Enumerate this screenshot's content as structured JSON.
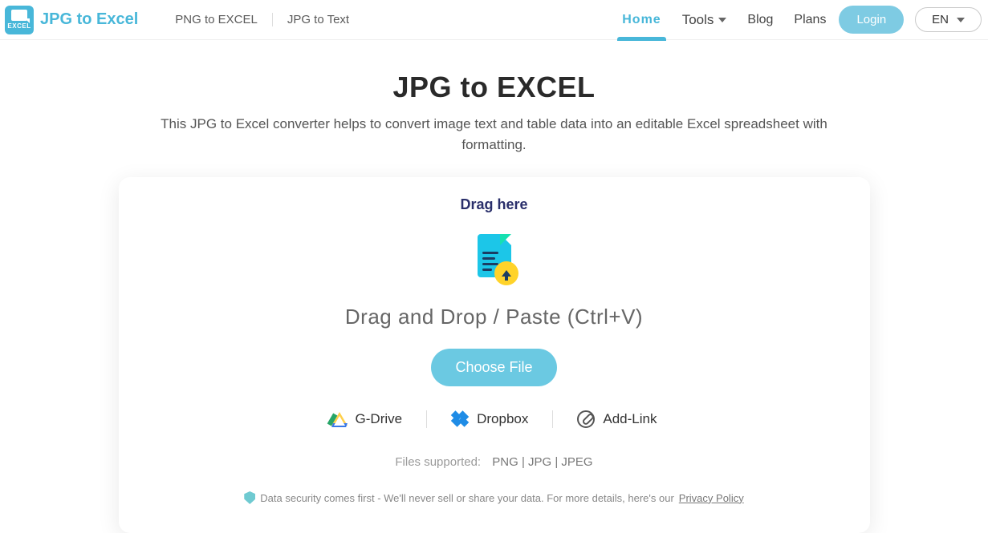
{
  "brand": {
    "name": "JPG to Excel",
    "logo_small_text": "EXCEL"
  },
  "nav_secondary": [
    {
      "label": "PNG to EXCEL"
    },
    {
      "label": "JPG to Text"
    }
  ],
  "nav_primary": {
    "home": "Home",
    "tools": "Tools",
    "blog": "Blog",
    "plans": "Plans"
  },
  "auth": {
    "login": "Login"
  },
  "lang": {
    "current": "EN"
  },
  "hero": {
    "title": "JPG to EXCEL",
    "subtitle": "This JPG to Excel converter helps to convert image text and table data into an editable Excel spreadsheet with formatting."
  },
  "uploader": {
    "drag_here": "Drag here",
    "dnd_text": "Drag and Drop / Paste (Ctrl+V)",
    "choose_file": "Choose File",
    "sources": {
      "gdrive": "G-Drive",
      "dropbox": "Dropbox",
      "addlink": "Add-Link"
    },
    "supported_label": "Files supported:",
    "supported_formats": "PNG | JPG | JPEG",
    "security_text": "Data security comes first - We'll never sell or share your data. For more details, here's our ",
    "privacy_link": "Privacy Policy"
  }
}
